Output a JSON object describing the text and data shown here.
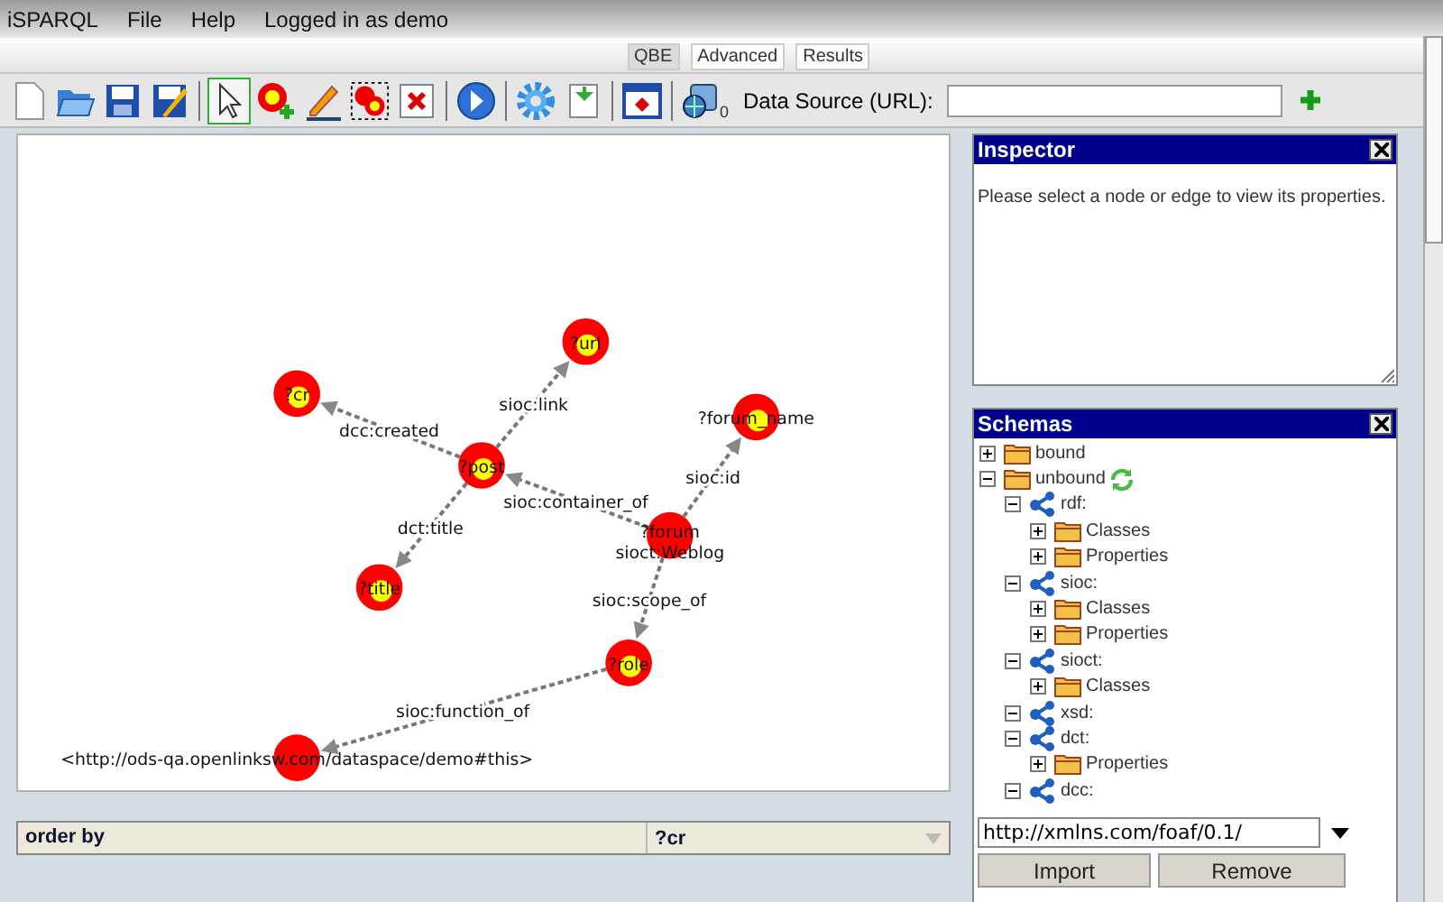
{
  "menu": {
    "items": [
      "iSPARQL",
      "File",
      "Help"
    ],
    "status": "Logged in as demo"
  },
  "tabs": [
    {
      "label": "QBE",
      "selected": true
    },
    {
      "label": "Advanced",
      "selected": false
    },
    {
      "label": "Results",
      "selected": false
    }
  ],
  "toolbar": {
    "tools": [
      {
        "kind": "new",
        "selected": false
      },
      {
        "kind": "open",
        "selected": false
      },
      {
        "kind": "save",
        "selected": false
      },
      {
        "kind": "saveas",
        "selected": false
      },
      {
        "kind": "sep"
      },
      {
        "kind": "pointer",
        "selected": true
      },
      {
        "kind": "addnode",
        "selected": false
      },
      {
        "kind": "pencil",
        "selected": false
      },
      {
        "kind": "multinode",
        "selected": false
      },
      {
        "kind": "delete",
        "selected": false
      },
      {
        "kind": "sep"
      },
      {
        "kind": "run",
        "selected": false
      },
      {
        "kind": "sep"
      },
      {
        "kind": "gear",
        "selected": false
      },
      {
        "kind": "import",
        "selected": false
      },
      {
        "kind": "sep"
      },
      {
        "kind": "window",
        "selected": false
      },
      {
        "kind": "sep"
      }
    ],
    "source_count": "0",
    "source_label": "Data Source (URL):"
  },
  "graph": {
    "nodes": [
      {
        "label": "?cr",
        "kind": "variable"
      },
      {
        "label": "?url",
        "kind": "variable"
      },
      {
        "label": "?post",
        "kind": "variable"
      },
      {
        "label": "?forum_name",
        "kind": "variable"
      },
      {
        "label": "?forum",
        "type": "sioct:Weblog",
        "kind": "resource"
      },
      {
        "label": "?title",
        "kind": "variable"
      },
      {
        "label": "?role",
        "kind": "variable"
      },
      {
        "label": "<http://ods-qa.openlinksw.com/dataspace/demo#this>",
        "kind": "resource"
      }
    ],
    "edges": [
      {
        "label": "dcc:created"
      },
      {
        "label": "sioc:link"
      },
      {
        "label": "dct:title"
      },
      {
        "label": "sioc:container_of"
      },
      {
        "label": "sioc:id"
      },
      {
        "label": "sioc:scope_of"
      },
      {
        "label": "sioc:function_of"
      }
    ]
  },
  "order_by": {
    "label": "order by",
    "value": "?cr"
  },
  "inspector": {
    "title": "Inspector",
    "message": "Please select a node or edge to view its properties."
  },
  "schemas": {
    "title": "Schemas",
    "tree": [
      {
        "label": "bound",
        "kind": "folder",
        "expanded": false,
        "refresh": false
      },
      {
        "label": "unbound",
        "kind": "folder",
        "expanded": true,
        "refresh": true,
        "children": [
          {
            "label": "rdf:",
            "kind": "namespace",
            "expanded": true,
            "children": [
              {
                "label": "Classes",
                "kind": "folder",
                "expanded": false
              },
              {
                "label": "Properties",
                "kind": "folder",
                "expanded": false
              }
            ]
          },
          {
            "label": "sioc:",
            "kind": "namespace",
            "expanded": true,
            "children": [
              {
                "label": "Classes",
                "kind": "folder",
                "expanded": false
              },
              {
                "label": "Properties",
                "kind": "folder",
                "expanded": false
              }
            ]
          },
          {
            "label": "sioct:",
            "kind": "namespace",
            "expanded": true,
            "children": [
              {
                "label": "Classes",
                "kind": "folder",
                "expanded": false
              }
            ]
          },
          {
            "label": "xsd:",
            "kind": "namespace",
            "expanded": true
          },
          {
            "label": "dct:",
            "kind": "namespace",
            "expanded": true,
            "children": [
              {
                "label": "Properties",
                "kind": "folder",
                "expanded": false
              }
            ]
          },
          {
            "label": "dcc:",
            "kind": "namespace",
            "expanded": true
          }
        ]
      }
    ],
    "url": "http://xmlns.com/foaf/0.1/",
    "buttons": [
      "Import",
      "Remove"
    ]
  }
}
